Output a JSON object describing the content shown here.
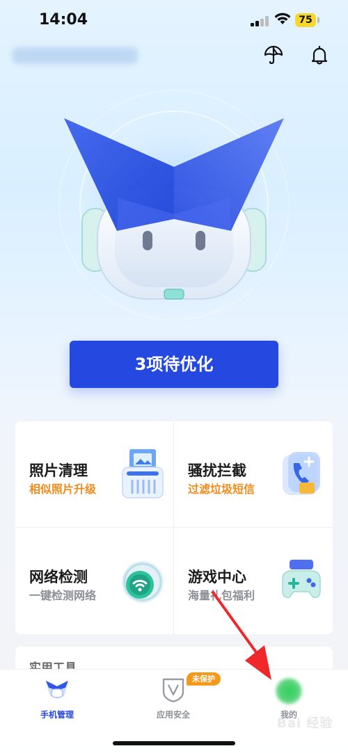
{
  "status": {
    "time": "14:04",
    "battery": "75"
  },
  "header": {
    "account_name": ""
  },
  "cta": {
    "label": "3项待优化"
  },
  "cards": [
    {
      "title": "照片清理",
      "subtitle": "相似照片升级",
      "subtitle_color": "#f08b1c",
      "icon": "shredder-icon"
    },
    {
      "title": "骚扰拦截",
      "subtitle": "过滤垃圾短信",
      "subtitle_color": "#f08b1c",
      "icon": "phone-block-icon"
    },
    {
      "title": "网络检测",
      "subtitle": "一键检测网络",
      "subtitle_color": "#8c8f96",
      "icon": "wifi-check-icon"
    },
    {
      "title": "游戏中心",
      "subtitle": "海量礼包福利",
      "subtitle_color": "#8c8f96",
      "icon": "gamepad-icon"
    }
  ],
  "section": {
    "tools_title": "实用工具"
  },
  "tabbar": {
    "tabs": [
      {
        "label": "手机管理",
        "active": true
      },
      {
        "label": "应用安全",
        "active": false,
        "badge": "未保护"
      },
      {
        "label": "我的",
        "active": false
      }
    ]
  },
  "colors": {
    "accent": "#2448e0",
    "badge": "#f39a1d",
    "warning_text": "#f08b1c",
    "arrow": "#f0282a"
  },
  "watermark": "Bai 经验"
}
